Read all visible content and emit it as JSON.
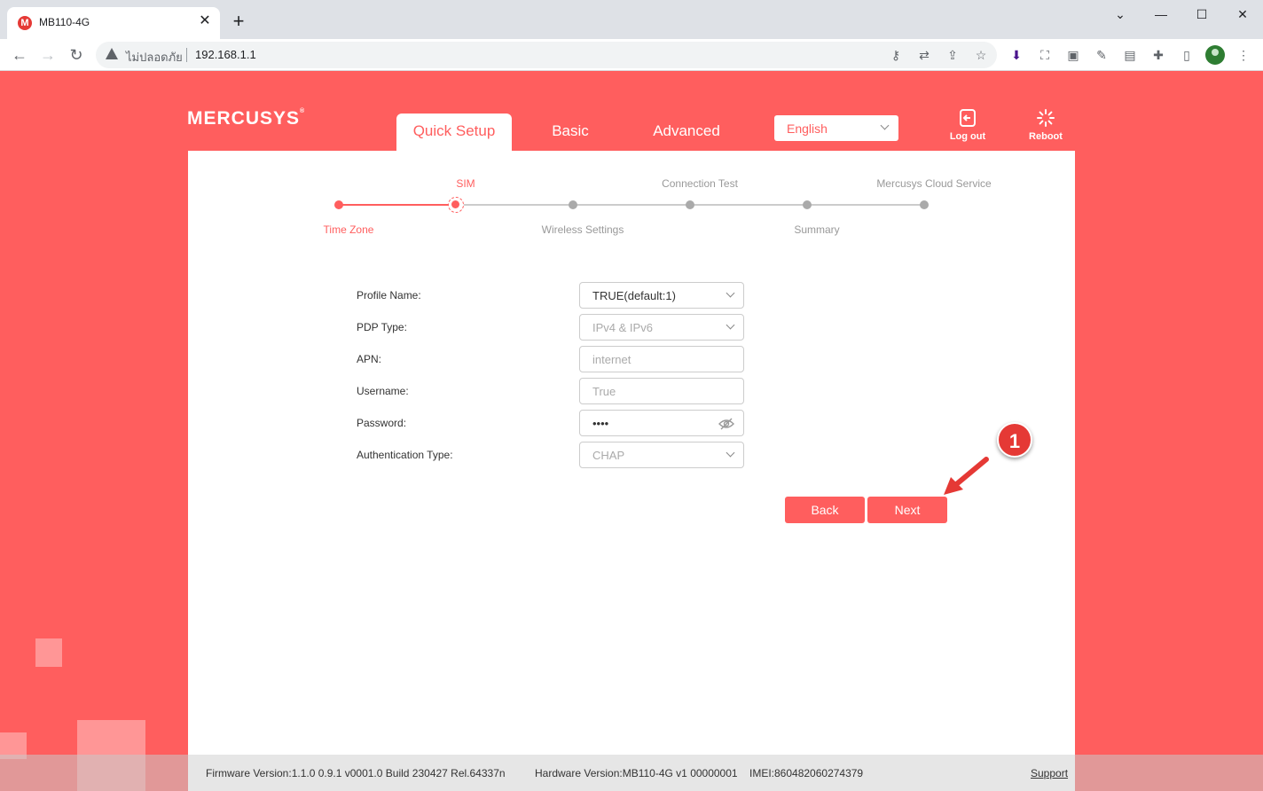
{
  "browser": {
    "tab_title": "MB110-4G",
    "tab_favicon_letter": "M",
    "security_warning": "ไม่ปลอดภัย",
    "url": "192.168.1.1"
  },
  "router": {
    "brand": "MERCUSYS",
    "nav_tabs": [
      {
        "label": "Quick Setup",
        "active": true
      },
      {
        "label": "Basic",
        "active": false
      },
      {
        "label": "Advanced",
        "active": false
      }
    ],
    "language": "English",
    "logout_label": "Log out",
    "reboot_label": "Reboot",
    "accent_color": "#ff5e5e"
  },
  "wizard": {
    "steps": [
      {
        "label": "Time Zone",
        "state": "done"
      },
      {
        "label": "SIM",
        "state": "current"
      },
      {
        "label": "Wireless Settings",
        "state": "pending"
      },
      {
        "label": "Connection Test",
        "state": "pending"
      },
      {
        "label": "Summary",
        "state": "pending"
      },
      {
        "label": "Mercusys Cloud Service",
        "state": "pending"
      }
    ]
  },
  "form": {
    "profile_name": {
      "label": "Profile Name:",
      "value": "TRUE(default:1)"
    },
    "pdp_type": {
      "label": "PDP Type:",
      "value": "IPv4 & IPv6"
    },
    "apn": {
      "label": "APN:",
      "value": "internet"
    },
    "username": {
      "label": "Username:",
      "value": "True"
    },
    "password": {
      "label": "Password:",
      "value": "••••"
    },
    "auth_type": {
      "label": "Authentication Type:",
      "value": "CHAP"
    }
  },
  "buttons": {
    "back": "Back",
    "next": "Next"
  },
  "annotation": {
    "step_number": "1"
  },
  "footer": {
    "firmware": "Firmware Version:1.1.0 0.9.1 v0001.0 Build 230427 Rel.64337n",
    "hardware": "Hardware Version:MB110-4G v1 00000001",
    "imei": "IMEI:860482060274379",
    "support": "Support"
  }
}
